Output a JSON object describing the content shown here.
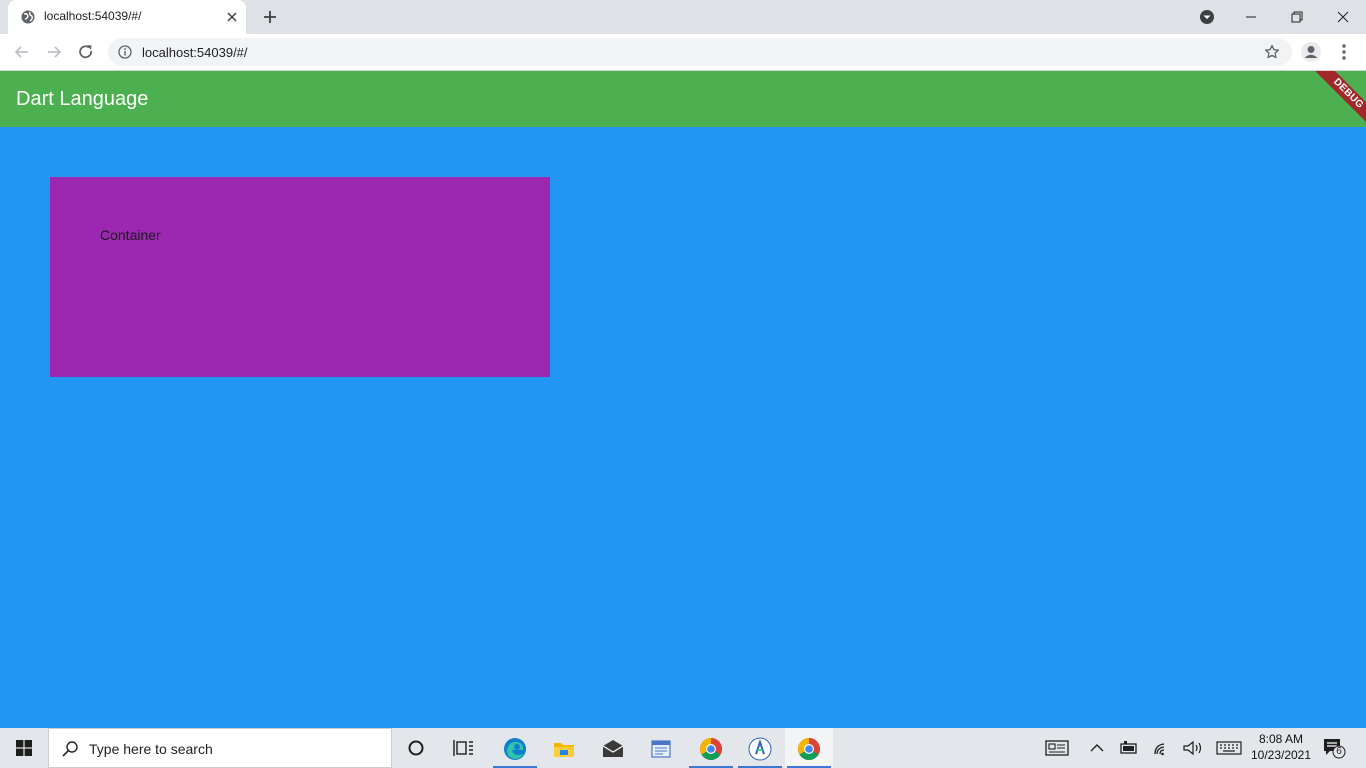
{
  "browser": {
    "tab_title": "localhost:54039/#/",
    "url": "localhost:54039/#/"
  },
  "app": {
    "title": "Dart Language",
    "debug_banner": "DEBUG",
    "container_label": "Container"
  },
  "taskbar": {
    "search_placeholder": "Type here to search",
    "time": "8:08 AM",
    "date": "10/23/2021",
    "notification_count": "6"
  },
  "colors": {
    "appbar": "#4CAF50",
    "body": "#2196F3",
    "container": "#9C27B0",
    "debug_banner": "#A0282B"
  }
}
